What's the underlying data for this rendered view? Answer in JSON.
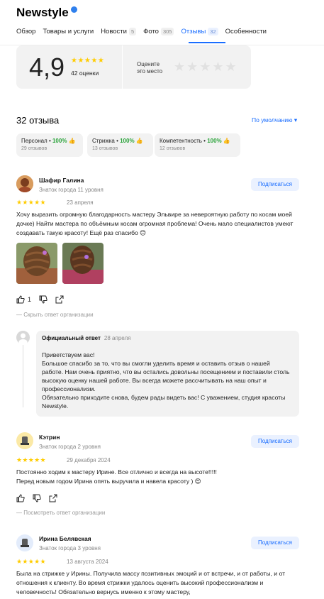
{
  "header": {
    "title": "Newstyle",
    "tabs": [
      {
        "label": "Обзор",
        "count": ""
      },
      {
        "label": "Товары и услуги",
        "count": ""
      },
      {
        "label": "Новости",
        "count": "5"
      },
      {
        "label": "Фото",
        "count": "305"
      },
      {
        "label": "Отзывы",
        "count": "32"
      },
      {
        "label": "Особенности",
        "count": ""
      }
    ],
    "active_tab": "Отзывы"
  },
  "rating_card": {
    "rating": "4,9",
    "stars": "★★★★★",
    "reviews_count": "42 оценки",
    "rate_prompt_line1": "Оцените",
    "rate_prompt_line2": "это место",
    "empty_stars": "★★★★★"
  },
  "reviews_section": {
    "title": "32 отзыва",
    "sort_label": "По умолчанию ▾",
    "aspects": [
      {
        "name": "Персонал",
        "percent": "100%",
        "sub": "29 отзывов"
      },
      {
        "name": "Стрижка",
        "percent": "100%",
        "sub": "13 отзывов"
      },
      {
        "name": "Компетентность",
        "percent": "100%",
        "sub": "12 отзывов"
      }
    ]
  },
  "reviews": [
    {
      "name": "Шафир Галина",
      "level": "Знаток города 11 уровня",
      "subscribe": "Подписаться",
      "stars": "★★★★★",
      "date": "23 апреля",
      "text": "Хочу выразить огромную благодарность мастеру Эльвире за невероятную работу по косам моей дочке) Найти мастера по объёмным косам огромная проблема! Очень мало специалистов умеют создавать такую красоту! Ещё раз спасибо 😊",
      "likes": "1",
      "toggle_answer": "— Скрыть ответ организации",
      "org_answer": {
        "label": "Официальный ответ",
        "date": "28 апреля",
        "lines": [
          "Приветствуем вас!",
          "Большое спасибо за то, что вы смогли уделить время и оставить отзыв о нашей работе. Нам очень приятно, что вы остались довольны посещением и поставили столь высокую оценку нашей работе. Вы всегда можете рассчитывать на наш опыт и профессионализм.",
          "Обязательно приходите снова, будем рады видеть вас! С уважением, студия красоты Newstyle."
        ]
      }
    },
    {
      "name": "Кэтрин",
      "level": "Знаток города 2 уровня",
      "subscribe": "Подписаться",
      "stars": "★★★★★",
      "date": "29 декабря 2024",
      "text_line1": "Постоянно ходим к мастеру Ирине. Все отлично и всегда на высоте!!!!!",
      "text_line2": "Перед новым годом Ирина опять выручила и навела красоту ) 😍",
      "toggle_answer": "— Посмотреть ответ организации"
    },
    {
      "name": "Ирина Белявская",
      "level": "Знаток города 3 уровня",
      "subscribe": "Подписаться",
      "stars": "★★★★★",
      "date": "13 августа 2024",
      "text": "Была на стрижке у Ирины. Получила массу позитивных эмоций и от встречи, и от работы, и от отношения к клиенту. Во время стрижки удалось оценить высокий профессионализм и человечность! Обязательно вернусь именно к этому мастеру,"
    }
  ],
  "colors": {
    "accent": "#196dff",
    "star": "#ffcc00",
    "positive": "#2aa33a",
    "card_bg": "#f2f2f2"
  }
}
